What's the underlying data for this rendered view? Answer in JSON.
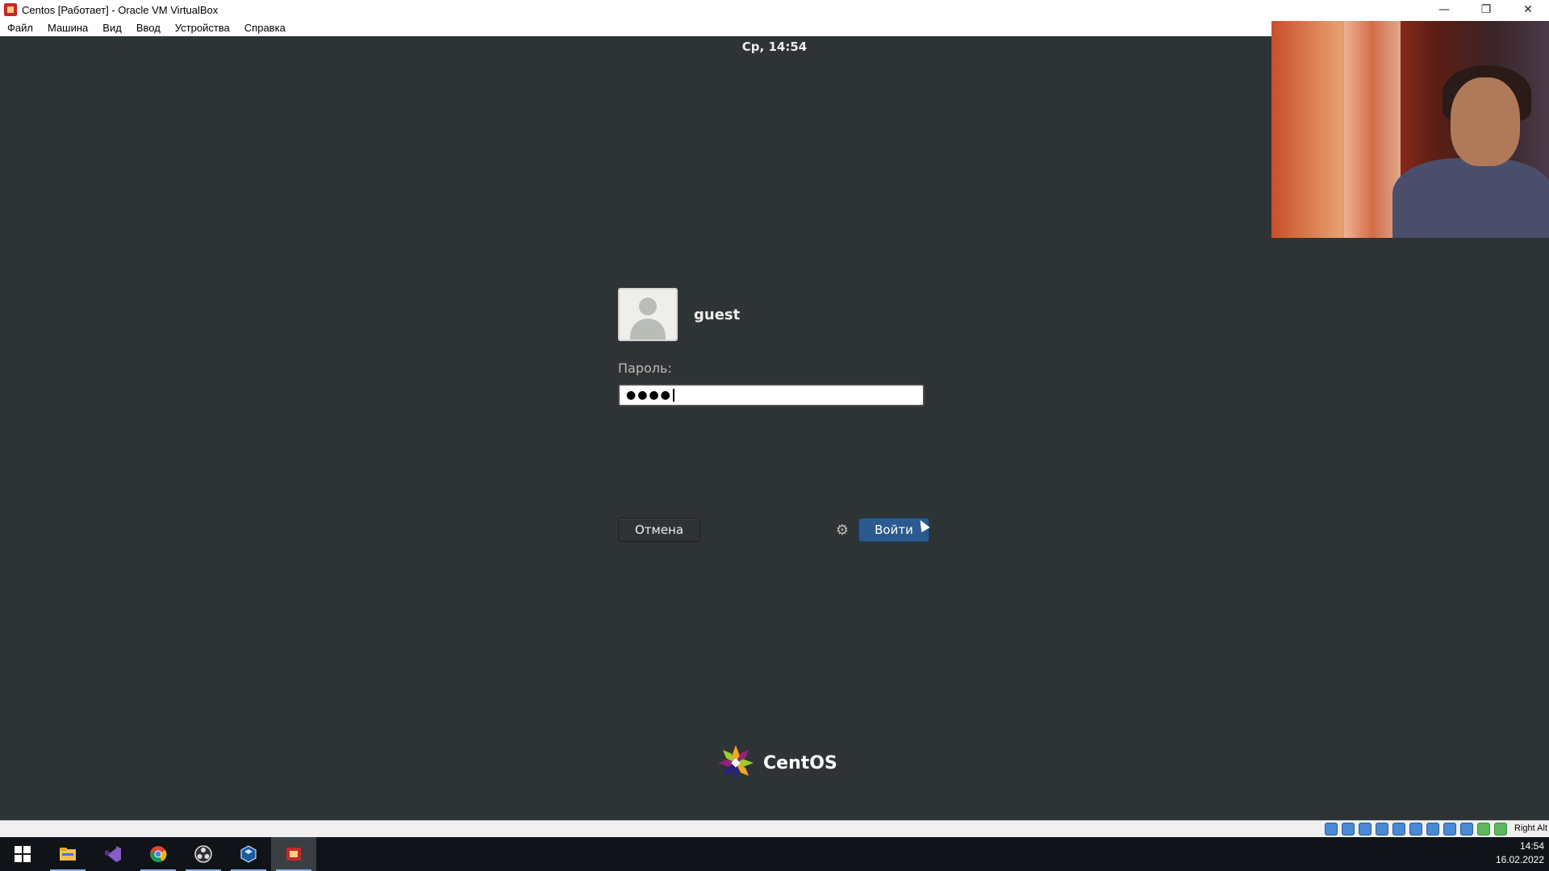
{
  "window": {
    "title": "Centos [Работает] - Oracle VM VirtualBox",
    "controls": {
      "minimize": "—",
      "restore": "❐",
      "close": "✕"
    }
  },
  "menubar": {
    "items": [
      "Файл",
      "Машина",
      "Вид",
      "Ввод",
      "Устройства",
      "Справка"
    ]
  },
  "vm": {
    "clock": "Ср, 14:54",
    "user": {
      "name": "guest"
    },
    "password": {
      "label": "Пароль:",
      "masked_value": "●●●●"
    },
    "buttons": {
      "cancel": "Отмена",
      "login": "Войти"
    },
    "brand": "CentOS"
  },
  "statusbar": {
    "host_key": "Right Alt"
  },
  "taskbar": {
    "items": [
      {
        "icon": "windows-start-icon"
      },
      {
        "icon": "file-explorer-icon"
      },
      {
        "icon": "visual-studio-icon"
      },
      {
        "icon": "chrome-icon"
      },
      {
        "icon": "obs-icon"
      },
      {
        "icon": "virtualbox-icon"
      },
      {
        "icon": "app-red-icon"
      }
    ],
    "clock": {
      "time": "14:54",
      "date": "16.02.2022"
    }
  },
  "colors": {
    "vm_background": "#2e3436",
    "login_button": "#2a5a8f"
  }
}
